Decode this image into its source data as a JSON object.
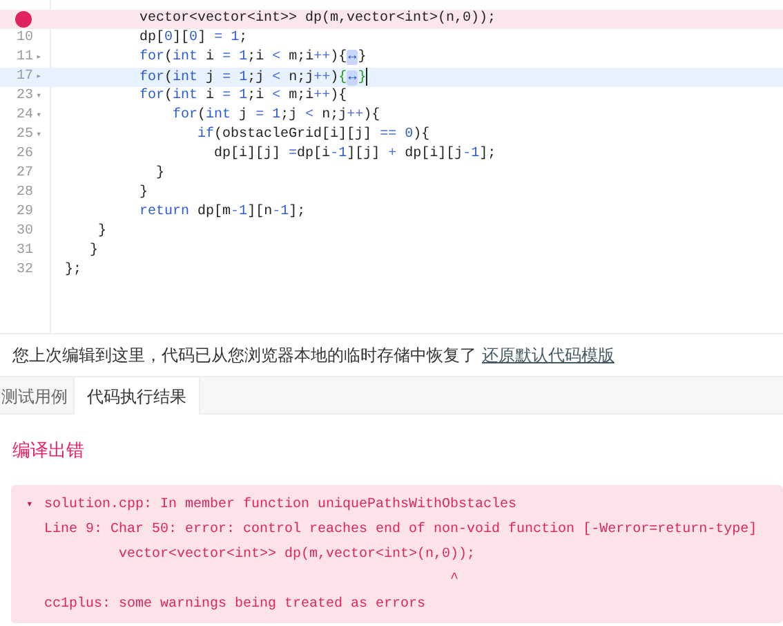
{
  "editor": {
    "lines": [
      {
        "error": true,
        "current": false,
        "segments": [
          {
            "kind": "plain",
            "text": "         vector<vector<int>> dp(m,vector<int>(n,0));"
          }
        ]
      },
      {
        "number": "10",
        "error": false,
        "current": false,
        "segments": [
          {
            "kind": "plain",
            "text": "         dp["
          },
          {
            "kind": "number",
            "text": "0"
          },
          {
            "kind": "plain",
            "text": "]["
          },
          {
            "kind": "number",
            "text": "0"
          },
          {
            "kind": "plain",
            "text": "] "
          },
          {
            "kind": "operator",
            "text": "="
          },
          {
            "kind": "number",
            "text": " 1"
          },
          {
            "kind": "plain",
            "text": ";"
          }
        ]
      },
      {
        "number": "11",
        "fold_marker": "▸",
        "error": false,
        "current": false,
        "segments": [
          {
            "kind": "keyword",
            "text": "         for"
          },
          {
            "kind": "plain",
            "text": "("
          },
          {
            "kind": "keyword",
            "text": "int"
          },
          {
            "kind": "plain",
            "text": " i "
          },
          {
            "kind": "operator",
            "text": "="
          },
          {
            "kind": "number",
            "text": " 1"
          },
          {
            "kind": "plain",
            "text": ";i "
          },
          {
            "kind": "operator",
            "text": "<"
          },
          {
            "kind": "plain",
            "text": " m;i"
          },
          {
            "kind": "operator",
            "text": "++"
          },
          {
            "kind": "plain",
            "text": "){"
          },
          {
            "kind": "fold",
            "text": "↔"
          },
          {
            "kind": "plain",
            "text": "}"
          }
        ]
      },
      {
        "number": "17",
        "fold_marker": "▸",
        "error": false,
        "current": true,
        "segments": [
          {
            "kind": "keyword",
            "text": "         for"
          },
          {
            "kind": "plain",
            "text": "("
          },
          {
            "kind": "keyword",
            "text": "int"
          },
          {
            "kind": "plain",
            "text": " j "
          },
          {
            "kind": "operator",
            "text": "="
          },
          {
            "kind": "number",
            "text": " 1"
          },
          {
            "kind": "plain",
            "text": ";j "
          },
          {
            "kind": "operator",
            "text": "<"
          },
          {
            "kind": "plain",
            "text": " n;j"
          },
          {
            "kind": "operator",
            "text": "++"
          },
          {
            "kind": "plain",
            "text": ")"
          },
          {
            "kind": "match",
            "text": "{"
          },
          {
            "kind": "fold",
            "text": "↔"
          },
          {
            "kind": "match",
            "text": "}"
          }
        ]
      },
      {
        "number": "23",
        "fold_marker": "▾",
        "error": false,
        "current": false,
        "segments": [
          {
            "kind": "keyword",
            "text": "         for"
          },
          {
            "kind": "plain",
            "text": "("
          },
          {
            "kind": "keyword",
            "text": "int"
          },
          {
            "kind": "plain",
            "text": " i "
          },
          {
            "kind": "operator",
            "text": "="
          },
          {
            "kind": "number",
            "text": " 1"
          },
          {
            "kind": "plain",
            "text": ";i "
          },
          {
            "kind": "operator",
            "text": "<"
          },
          {
            "kind": "plain",
            "text": " m;i"
          },
          {
            "kind": "operator",
            "text": "++"
          },
          {
            "kind": "plain",
            "text": "){"
          }
        ]
      },
      {
        "number": "24",
        "fold_marker": "▾",
        "error": false,
        "current": false,
        "segments": [
          {
            "kind": "keyword",
            "text": "             for"
          },
          {
            "kind": "plain",
            "text": "("
          },
          {
            "kind": "keyword",
            "text": "int"
          },
          {
            "kind": "plain",
            "text": " j "
          },
          {
            "kind": "operator",
            "text": "="
          },
          {
            "kind": "number",
            "text": " 1"
          },
          {
            "kind": "plain",
            "text": ";j "
          },
          {
            "kind": "operator",
            "text": "<"
          },
          {
            "kind": "plain",
            "text": " n;j"
          },
          {
            "kind": "operator",
            "text": "++"
          },
          {
            "kind": "plain",
            "text": "){"
          }
        ]
      },
      {
        "number": "25",
        "fold_marker": "▾",
        "error": false,
        "current": false,
        "segments": [
          {
            "kind": "keyword",
            "text": "                if"
          },
          {
            "kind": "plain",
            "text": "(obstacleGrid[i][j] "
          },
          {
            "kind": "operator",
            "text": "=="
          },
          {
            "kind": "number",
            "text": " 0"
          },
          {
            "kind": "plain",
            "text": "){"
          }
        ]
      },
      {
        "number": "26",
        "error": false,
        "current": false,
        "segments": [
          {
            "kind": "plain",
            "text": "                  dp[i][j] "
          },
          {
            "kind": "operator",
            "text": "="
          },
          {
            "kind": "plain",
            "text": "dp[i"
          },
          {
            "kind": "operator",
            "text": "-"
          },
          {
            "kind": "number",
            "text": "1"
          },
          {
            "kind": "plain",
            "text": "][j] "
          },
          {
            "kind": "operator",
            "text": "+"
          },
          {
            "kind": "plain",
            "text": " dp[i][j"
          },
          {
            "kind": "operator",
            "text": "-"
          },
          {
            "kind": "number",
            "text": "1"
          },
          {
            "kind": "plain",
            "text": "];"
          }
        ]
      },
      {
        "number": "27",
        "error": false,
        "current": false,
        "segments": [
          {
            "kind": "plain",
            "text": "           }"
          }
        ]
      },
      {
        "number": "28",
        "error": false,
        "current": false,
        "segments": [
          {
            "kind": "plain",
            "text": "         }"
          }
        ]
      },
      {
        "number": "29",
        "error": false,
        "current": false,
        "segments": [
          {
            "kind": "keyword",
            "text": "         return"
          },
          {
            "kind": "plain",
            "text": " dp[m"
          },
          {
            "kind": "operator",
            "text": "-"
          },
          {
            "kind": "number",
            "text": "1"
          },
          {
            "kind": "plain",
            "text": "][n"
          },
          {
            "kind": "operator",
            "text": "-"
          },
          {
            "kind": "number",
            "text": "1"
          },
          {
            "kind": "plain",
            "text": "];"
          }
        ]
      },
      {
        "number": "30",
        "error": false,
        "current": false,
        "segments": [
          {
            "kind": "plain",
            "text": "    }"
          }
        ]
      },
      {
        "number": "31",
        "error": false,
        "current": false,
        "segments": [
          {
            "kind": "plain",
            "text": "   }"
          }
        ]
      },
      {
        "number": "32",
        "error": false,
        "current": false,
        "segments": [
          {
            "kind": "plain",
            "text": "};"
          }
        ]
      }
    ]
  },
  "notice": {
    "text": "您上次编辑到这里，代码已从您浏览器本地的临时存储中恢复了",
    "link": "还原默认代码模版"
  },
  "tabs": [
    {
      "label": "测试用例",
      "selected": false
    },
    {
      "label": "代码执行结果",
      "selected": true
    }
  ],
  "result": {
    "status": "编译出错",
    "toggle": "▾",
    "lines": [
      "solution.cpp: In member function uniquePathsWithObstacles",
      "Line 9: Char 50: error: control reaches end of non-void function [-Werror=return-type]",
      "         vector<vector<int>> dp(m,vector<int>(n,0));",
      "                                                 ^",
      "cc1plus: some warnings being treated as errors"
    ]
  }
}
